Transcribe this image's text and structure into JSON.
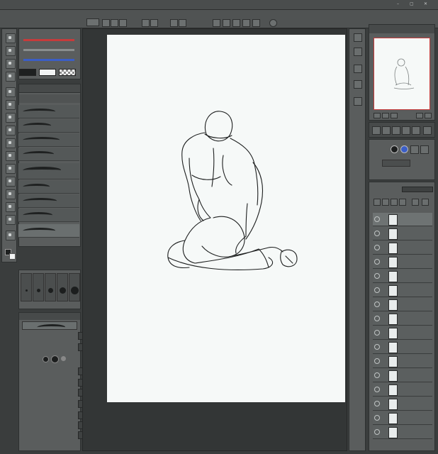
{
  "menu": {
    "items": [
      "",
      "",
      "",
      "",
      "",
      "",
      "",
      "",
      "",
      "",
      "",
      ""
    ]
  },
  "colors": {
    "main": "#1e2020",
    "sub": "#f2f4f4",
    "accent_red": "#c73b3b",
    "accent_blue": "#3b5ec7",
    "canvas": "#f6f9f8"
  },
  "brushes": {
    "group_label": "",
    "items": [
      "",
      "",
      "",
      "",
      "",
      "",
      "",
      "",
      ""
    ]
  },
  "tool_property": {
    "title": "",
    "rows": [
      "",
      "",
      "",
      "",
      "",
      "",
      "",
      "",
      "",
      ""
    ]
  },
  "navigator": {
    "title": ""
  },
  "layer_panel": {
    "blend_mode": "",
    "layers": [
      {
        "name": "",
        "mode": ""
      },
      {
        "name": "",
        "mode": ""
      },
      {
        "name": "",
        "mode": ""
      },
      {
        "name": "",
        "mode": ""
      },
      {
        "name": "",
        "mode": ""
      },
      {
        "name": "",
        "mode": ""
      },
      {
        "name": "",
        "mode": ""
      },
      {
        "name": "",
        "mode": ""
      },
      {
        "name": "",
        "mode": ""
      },
      {
        "name": "",
        "mode": ""
      },
      {
        "name": "",
        "mode": ""
      },
      {
        "name": "",
        "mode": ""
      },
      {
        "name": "",
        "mode": ""
      },
      {
        "name": "",
        "mode": ""
      },
      {
        "name": "",
        "mode": ""
      },
      {
        "name": "",
        "mode": ""
      }
    ]
  },
  "tools": [
    "cursor-icon",
    "zoom-icon",
    "move-icon",
    "select-icon",
    "lasso-icon",
    "eyedropper-icon",
    "pen-icon",
    "pencil-icon",
    "brush-icon",
    "airbrush-icon",
    "eraser-icon",
    "fill-icon",
    "gradient-icon",
    "figure-icon",
    "text-icon",
    "ruler-icon"
  ]
}
